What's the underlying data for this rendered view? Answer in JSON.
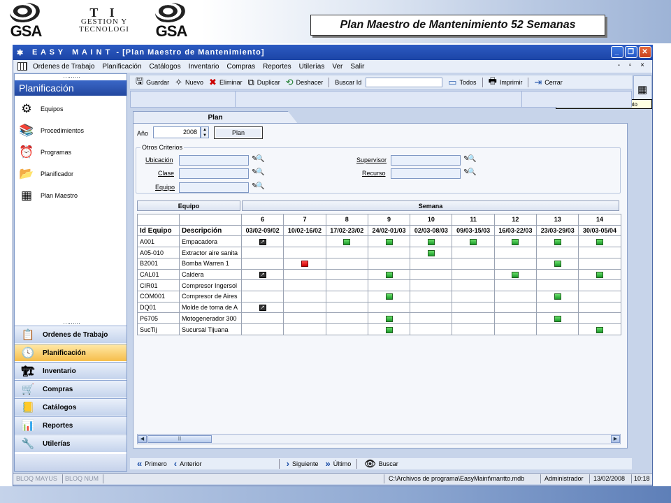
{
  "slide": {
    "logo_text": "GSA",
    "ti_big": "T I",
    "ti_line1": "GESTION Y",
    "ti_line2": "TECNOLOGI",
    "title": "Plan Maestro de Mantenimiento 52 Semanas"
  },
  "window": {
    "title": "E A S Y   M A I N T  - [Plan Maestro de Mantenimiento]",
    "min": "_",
    "max": "❐",
    "close": "✕"
  },
  "menu": {
    "items": [
      "Ordenes de Trabajo",
      "Planificación",
      "Catálogos",
      "Inventario",
      "Compras",
      "Reportes",
      "Utilerías",
      "Ver",
      "Salir"
    ],
    "right": "- ▫ ×"
  },
  "sidebar": {
    "title": "Planificación",
    "items": [
      {
        "label": "Equipos",
        "icon": "gear-icon"
      },
      {
        "label": "Procedimientos",
        "icon": "books-icon"
      },
      {
        "label": "Programas",
        "icon": "clock-icon"
      },
      {
        "label": "Planificador",
        "icon": "folder-icon"
      },
      {
        "label": "Plan Maestro",
        "icon": "table-icon"
      }
    ],
    "modules": [
      {
        "label": "Ordenes de Trabajo",
        "icon": "ot-icon"
      },
      {
        "label": "Planificación",
        "icon": "planning-icon"
      },
      {
        "label": "Inventario",
        "icon": "inventory-icon"
      },
      {
        "label": "Compras",
        "icon": "shopping-icon"
      },
      {
        "label": "Catálogos",
        "icon": "catalog-icon"
      },
      {
        "label": "Reportes",
        "icon": "reports-icon"
      },
      {
        "label": "Utilerías",
        "icon": "utilities-icon"
      }
    ],
    "selected_module": "Planificación"
  },
  "toolbar": {
    "guardar": "Guardar",
    "nuevo": "Nuevo",
    "eliminar": "Eliminar",
    "duplicar": "Duplicar",
    "deshacer": "Deshacer",
    "buscar_id": "Buscar Id",
    "todos": "Todos",
    "imprimir": "Imprimir",
    "cerrar": "Cerrar"
  },
  "tooltip": "Plan Maestro de Mantenimiento",
  "tab": {
    "label": "Plan"
  },
  "form": {
    "year_label": "Año",
    "year_value": "2008",
    "plan_button": "Plan",
    "otros_criterios": "Otros Criterios",
    "ubicacion": "Ubicación",
    "clase": "Clase",
    "equipo": "Equipo",
    "supervisor": "Supervisor",
    "recurso": "Recurso"
  },
  "grid": {
    "group_equipo": "Equipo",
    "group_semana": "Semana",
    "col_id": "Id Equipo",
    "col_desc": "Descripción",
    "weeks": [
      "6",
      "7",
      "8",
      "9",
      "10",
      "11",
      "12",
      "13",
      "14"
    ],
    "ranges": [
      "03/02-09/02",
      "10/02-16/02",
      "17/02-23/02",
      "24/02-01/03",
      "02/03-08/03",
      "09/03-15/03",
      "16/03-22/03",
      "23/03-29/03",
      "30/03-05/04"
    ],
    "rows": [
      {
        "id": "A001",
        "desc": "Empacadora",
        "marks": [
          "k",
          "",
          "g",
          "g",
          "g",
          "g",
          "g",
          "g",
          "g"
        ]
      },
      {
        "id": "A05-010",
        "desc": "Extractor aire sanita",
        "marks": [
          "",
          "",
          "",
          "",
          "g",
          "",
          "",
          "",
          ""
        ]
      },
      {
        "id": "B2001",
        "desc": "Bomba Warren 1",
        "marks": [
          "",
          "r",
          "",
          "",
          "",
          "",
          "",
          "g",
          ""
        ]
      },
      {
        "id": "CAL01",
        "desc": "Caldera",
        "marks": [
          "k",
          "",
          "",
          "g",
          "",
          "",
          "g",
          "",
          "g"
        ]
      },
      {
        "id": "CIR01",
        "desc": "Compresor Ingersol",
        "marks": [
          "",
          "",
          "",
          "",
          "",
          "",
          "",
          "",
          ""
        ]
      },
      {
        "id": "COM001",
        "desc": "Compresor de Aires",
        "marks": [
          "",
          "",
          "",
          "g",
          "",
          "",
          "",
          "g",
          ""
        ]
      },
      {
        "id": "DQ01",
        "desc": "Molde de toma de A",
        "marks": [
          "k",
          "",
          "",
          "",
          "",
          "",
          "",
          "",
          ""
        ]
      },
      {
        "id": "P6705",
        "desc": "Motogenerador 300",
        "marks": [
          "",
          "",
          "",
          "g",
          "",
          "",
          "",
          "g",
          ""
        ]
      },
      {
        "id": "SucTij",
        "desc": "Sucursal Tijuana",
        "marks": [
          "",
          "",
          "",
          "g",
          "",
          "",
          "",
          "",
          "g"
        ]
      }
    ]
  },
  "nav": {
    "primero": "Primero",
    "anterior": "Anterior",
    "siguiente": "Siguiente",
    "ultimo": "Último",
    "buscar": "Buscar"
  },
  "status": {
    "mayus": "BLOQ MAYUS",
    "num": "BLOQ NUM",
    "path": "C:\\Archivos de programa\\EasyMaint\\mantto.mdb",
    "user": "Administrador",
    "date": "13/02/2008",
    "time": "10:18"
  }
}
